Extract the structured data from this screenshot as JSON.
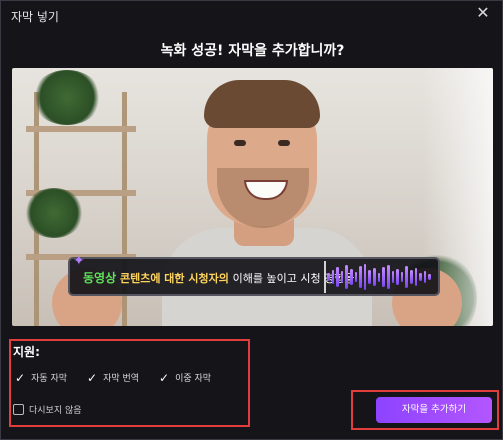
{
  "window": {
    "title": "자막 넣기",
    "close_icon": "close-icon"
  },
  "heading": "녹화 성공! 자막을 추가합니까?",
  "preview": {
    "subtitle": {
      "word1": "동영상",
      "word2": "콘텐츠에 대한 시청자의",
      "word3": "이해를 높이고 시청 경험을"
    }
  },
  "support": {
    "label": "지원:",
    "options": [
      "자동 자막",
      "자막 번역",
      "이중 자막"
    ],
    "dont_show_again": "다시보지 않음"
  },
  "actions": {
    "add_subtitles": "자막을 추가하기"
  },
  "colors": {
    "accent": "#9a4dff",
    "highlight_border": "#e23d3d",
    "subtitle_green": "#5fe15c",
    "subtitle_yellow": "#ffd45c"
  }
}
